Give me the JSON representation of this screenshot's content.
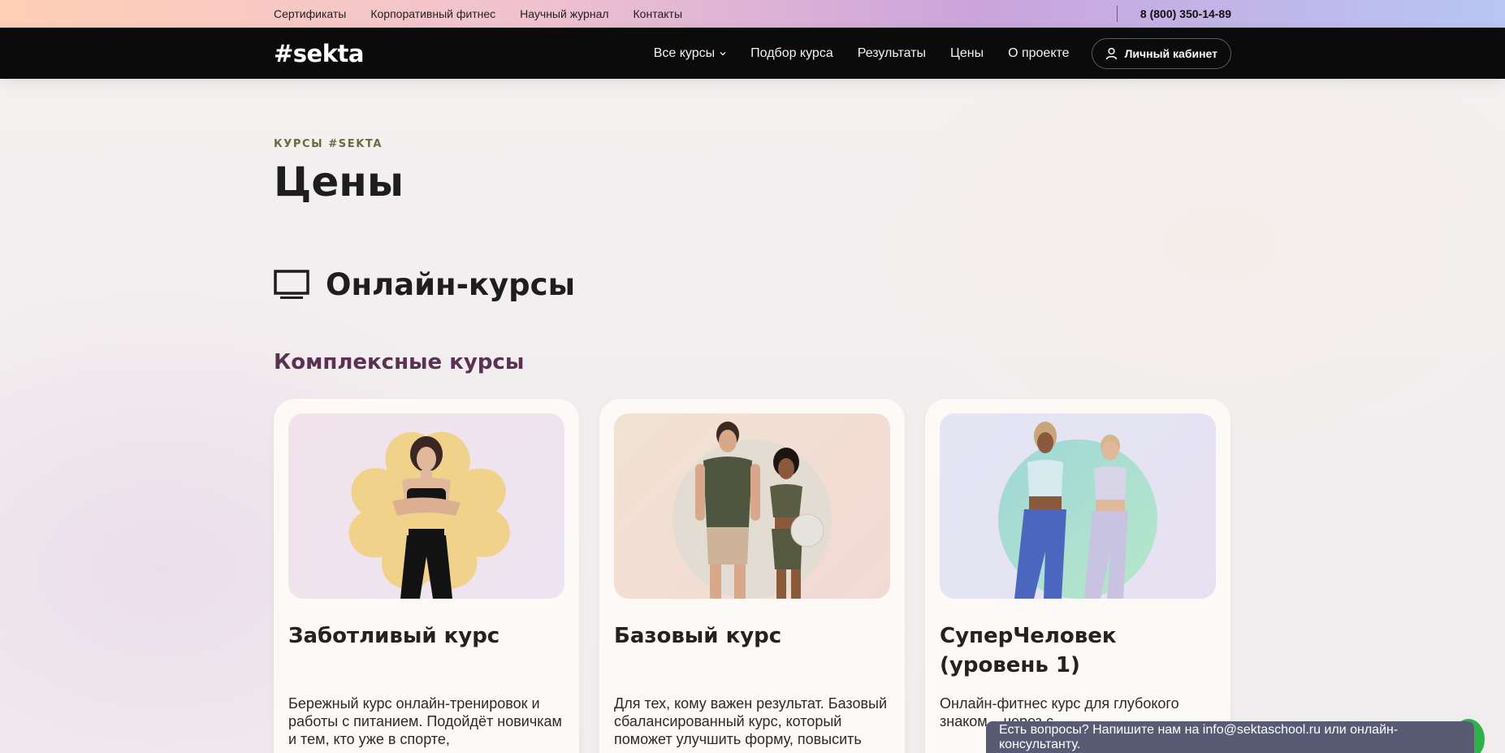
{
  "topbar": {
    "links": [
      "Сертификаты",
      "Корпоративный фитнес",
      "Научный журнал",
      "Контакты"
    ],
    "phone": "8 (800) 350-14-89"
  },
  "navbar": {
    "logo": "#sekta",
    "links": [
      "Все курсы",
      "Подбор курса",
      "Результаты",
      "Цены",
      "О проекте"
    ],
    "cabinet": "Личный кабинет"
  },
  "page": {
    "eyebrow": "КУРСЫ #SEKTA",
    "title": "Цены",
    "section": "Онлайн-курсы",
    "subsection": "Комплексные курсы"
  },
  "cards": [
    {
      "title": "Заботливый курс",
      "desc": "Бережный курс онлайн-тренировок и работы с питанием. Подойдёт новичкам и тем, кто уже в спорте,"
    },
    {
      "title": "Базовый курс",
      "desc": "Для тех, кому важен результат. Базовый сбалансированный курс, который поможет улучшить форму, повысить"
    },
    {
      "title": "СуперЧеловек (уровень 1)",
      "desc": "Онлайн-фитнес курс для глубокого знаком... через с..."
    }
  ],
  "chat": {
    "text": "Есть вопросы? Напишите нам на info@sektaschool.ru или онлайн-консультанту."
  },
  "colors": {
    "accent_eyebrow": "#6d6a3c",
    "accent_subsection": "#5b3053",
    "navbar_bg": "#0b0b0b"
  }
}
